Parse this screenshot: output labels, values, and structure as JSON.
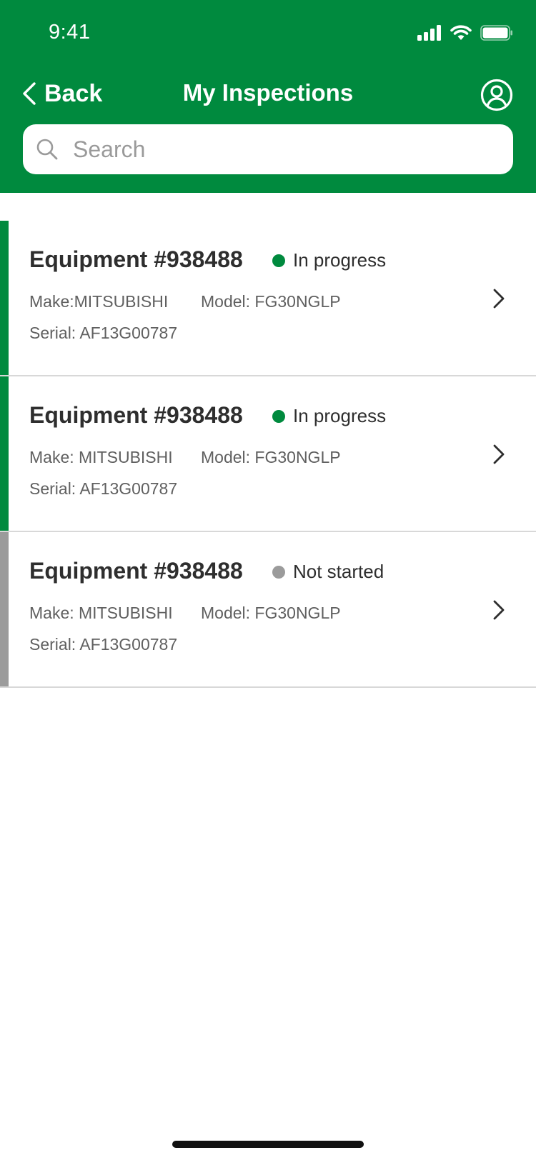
{
  "status_bar": {
    "time": "9:41"
  },
  "nav": {
    "back_label": "Back",
    "title": "My Inspections"
  },
  "search": {
    "placeholder": "Search",
    "value": ""
  },
  "colors": {
    "brand_green": "#008a3e",
    "in_progress": "#008a3e",
    "not_started": "#9b9b9b"
  },
  "inspections": [
    {
      "title": "Equipment #938488",
      "status": "In progress",
      "status_color": "#008a3e",
      "make": "Make:MITSUBISHI",
      "model": "Model: FG30NGLP",
      "serial": "Serial: AF13G00787"
    },
    {
      "title": "Equipment #938488",
      "status": "In progress",
      "status_color": "#008a3e",
      "make": "Make: MITSUBISHI",
      "model": "Model: FG30NGLP",
      "serial": "Serial: AF13G00787"
    },
    {
      "title": "Equipment #938488",
      "status": "Not started",
      "status_color": "#9b9b9b",
      "make": "Make: MITSUBISHI",
      "model": "Model: FG30NGLP",
      "serial": "Serial: AF13G00787"
    }
  ]
}
